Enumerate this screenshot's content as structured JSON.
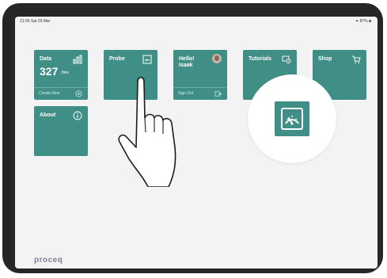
{
  "status_bar": {
    "time": "21:00  Sat 29 Mar",
    "right": "✦ 87% ■"
  },
  "tiles": {
    "data": {
      "title": "Data",
      "value": "327",
      "unit": "files",
      "footer": "Create New",
      "icon": "data-bars-icon"
    },
    "probe": {
      "title": "Probe",
      "icon": "gauge-icon"
    },
    "profile": {
      "title": "Hello!",
      "name": "Isaak",
      "footer": "Sign Out",
      "icon": "avatar"
    },
    "tutorials": {
      "title": "Tutorials",
      "icon": "tutorials-icon"
    },
    "shop": {
      "title": "Shop",
      "icon": "cart-icon"
    },
    "about": {
      "title": "About",
      "icon": "info-icon"
    }
  },
  "brand": {
    "logo": "proceq"
  },
  "colors": {
    "tile": "#3f8f86",
    "background": "#f3f3f3",
    "frame": "#262626",
    "logo": "#7d7d95"
  }
}
